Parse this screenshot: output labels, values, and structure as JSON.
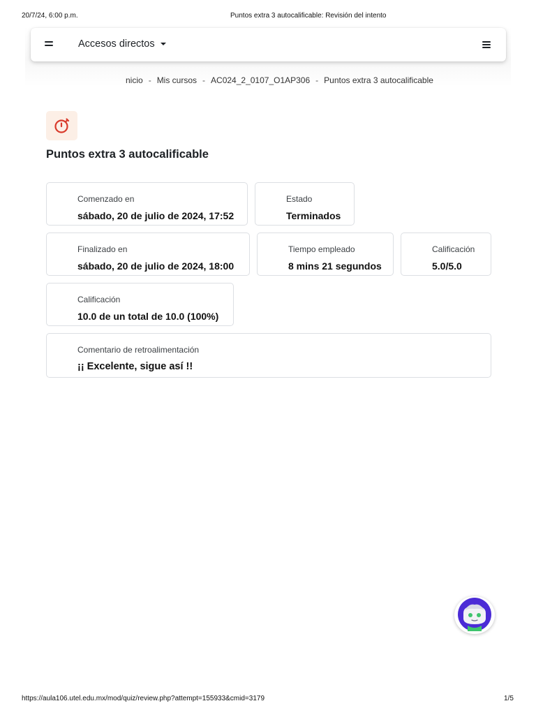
{
  "print_header": {
    "date": "20/7/24, 6:00 p.m.",
    "title": "Puntos extra 3 autocalificable: Revisión del intento"
  },
  "navbar": {
    "shortcuts_label": "Accesos directos"
  },
  "breadcrumb": [
    "nicio",
    "Mis cursos",
    "AC024_2_0107_O1AP306",
    "Puntos extra 3 autocalificable"
  ],
  "breadcrumb_separator": "-",
  "page_title": "Puntos extra 3 autocalificable",
  "summary": {
    "started": {
      "label": "Comenzado en",
      "value": "sábado, 20 de julio de 2024, 17:52"
    },
    "state": {
      "label": "Estado",
      "value": "Terminados"
    },
    "finished": {
      "label": "Finalizado en",
      "value": "sábado, 20 de julio de 2024, 18:00"
    },
    "time_taken": {
      "label": "Tiempo empleado",
      "value": "8 mins 21 segundos"
    },
    "marks": {
      "label": "Calificación",
      "value": "5.0/5.0"
    },
    "grade": {
      "label": "Calificación",
      "value": "10.0 de un total de 10.0 (100%)"
    },
    "feedback": {
      "label": "Comentario de retroalimentación",
      "value": "¡¡ Excelente, sigue así !!"
    }
  },
  "icons": {
    "activity": "stopwatch-icon",
    "chatbot": "chatbot-avatar-icon"
  },
  "colors": {
    "activity_icon_bg": "#fcefe6",
    "activity_icon_fg": "#d93a2b",
    "chatbot_purple": "#4b2bd6"
  },
  "print_footer": {
    "url": "https://aula106.utel.edu.mx/mod/quiz/review.php?attempt=155933&cmid=3179",
    "page": "1/5"
  }
}
